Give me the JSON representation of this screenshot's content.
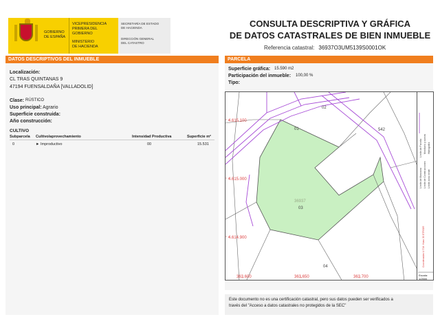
{
  "header": {
    "gov_name": "GOBIERNO DE ESPAÑA",
    "vice_line1": "VICEPRESIDENCIA",
    "vice_line2": "PRIMERA DEL GOBIERNO",
    "min_line1": "MINISTERIO",
    "min_line2": "DE HACIENDA",
    "sec_line1": "SECRETARÍA DE ESTADO",
    "sec_line2": "DE HACIENDA",
    "dir_line1": "DIRECCIÓN GENERAL",
    "dir_line2": "DEL CATASTRO",
    "title_line1": "CONSULTA DESCRIPTIVA Y GRÁFICA",
    "title_line2": "DE DATOS CATASTRALES DE BIEN INMUEBLE",
    "ref_label": "Referencia catastral:",
    "ref_value": "36937O3UM5139S0001OK"
  },
  "left": {
    "section_title": "DATOS DESCRIPTIVOS DEL INMUEBLE",
    "localizacion_label": "Localización:",
    "address_line1": "CL TRAS QUINTANAS 9",
    "address_line2": "47194 FUENSALDAÑA [VALLADOLID]",
    "clase_label": "Clase:",
    "clase_value": "RÚSTICO",
    "uso_label": "Uso principal:",
    "uso_value": "Agrario",
    "sup_label": "Superficie construida:",
    "anio_label": "Año construcción:",
    "cultivo_title": "CULTIVO",
    "cols": [
      "Subparcela",
      "Cultivo/aprovechamiento",
      "Intensidad Productiva",
      "Superficie m²"
    ],
    "row": [
      "0",
      "► Improductivo",
      "00",
      "15.531"
    ]
  },
  "right": {
    "section_title": "PARCELA",
    "sup_grafica_label": "Superficie gráfica:",
    "sup_grafica_value": "15.590 m2",
    "participacion_label": "Participación del inmueble:",
    "participacion_value": "100,00 %",
    "tipo_label": "Tipo:"
  },
  "map": {
    "y_labels": [
      "4.615.100",
      "4.615.000",
      "4.614.900"
    ],
    "x_labels": [
      "363.600",
      "363.650",
      "363.700"
    ],
    "parcel_labels": [
      "02",
      "01",
      "542",
      "36937",
      "03",
      "04"
    ],
    "escala_label": "Escala:",
    "escala_value": "1/2500",
    "legend_items": [
      "Límite de Manzana",
      "Límite de Parcela",
      "Límite de Construcciones",
      "Mobiliario y aceras",
      "Límite zona verde",
      "Hidrografía"
    ],
    "legend_ref": "Coordenadas U.T.M. Huso 30 ETRS89",
    "fill_color": "#c9f0c2",
    "line_color": "#a64ad6"
  },
  "footer": {
    "line1": "Este documento no es una certificación catastral, pero sus datos pueden ser verificados a",
    "line2": "través del \"Acceso a datos catastrales no protegidos de la SEC\""
  }
}
